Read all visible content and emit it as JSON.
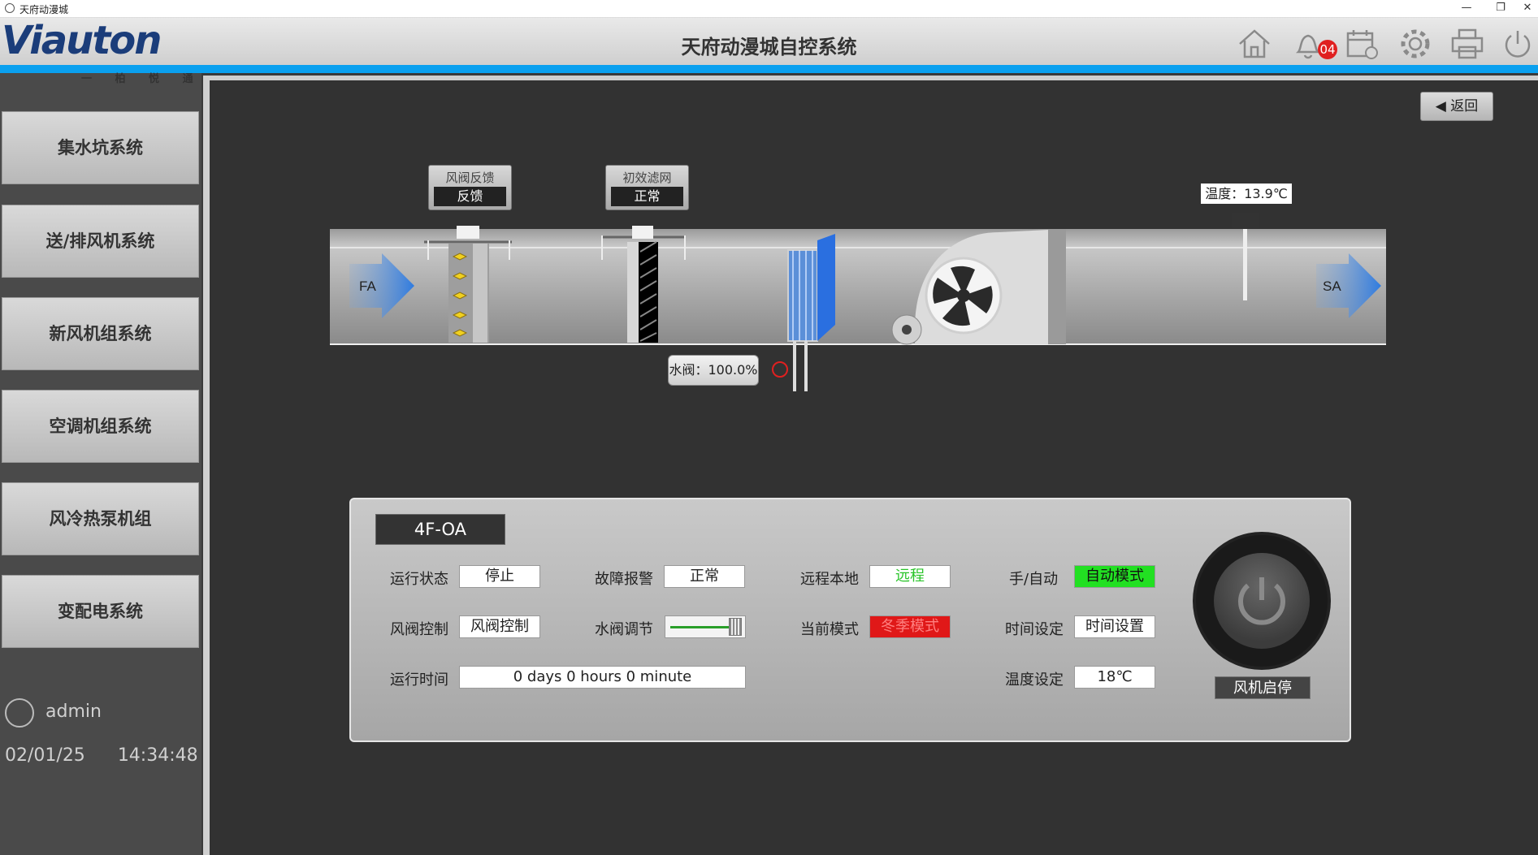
{
  "window": {
    "title": "天府动漫城",
    "minimize": "—",
    "restore": "❐",
    "close": "✕"
  },
  "header": {
    "logo": "Viauton",
    "logo_sub": "一 柏 悦 通 一",
    "title": "天府动漫城自控系统",
    "alarm_count": "04"
  },
  "header_icons": [
    "home-icon",
    "bell-icon",
    "calendar-icon",
    "gear-icon",
    "printer-icon",
    "power-icon"
  ],
  "sidebar": {
    "items": [
      {
        "label": "集水坑系统"
      },
      {
        "label": "送/排风机系统"
      },
      {
        "label": "新风机组系统"
      },
      {
        "label": "空调机组系统"
      },
      {
        "label": "风冷热泵机组"
      },
      {
        "label": "变配电系统"
      }
    ],
    "user": "admin",
    "date": "02/01/25",
    "time": "14:34:48"
  },
  "back_button": "返回",
  "diagram": {
    "damper_feedback": {
      "label": "风阀反馈",
      "value": "反馈"
    },
    "filter": {
      "label": "初效滤网",
      "value": "正常"
    },
    "inlet": "FA",
    "outlet": "SA",
    "temperature": "温度：13.9℃",
    "water_valve": "水阀：100.0%"
  },
  "panel": {
    "unit_name": "4F-OA",
    "run_status": {
      "label": "运行状态",
      "value": "停止"
    },
    "fault_alarm": {
      "label": "故障报警",
      "value": "正常"
    },
    "remote_local": {
      "label": "远程本地",
      "value": "远程"
    },
    "manual_auto": {
      "label": "手/自动",
      "value": "自动模式"
    },
    "damper_control": {
      "label": "风阀控制",
      "value": "风阀控制"
    },
    "water_valve_adjust": {
      "label": "水阀调节",
      "level": 1.0
    },
    "current_mode": {
      "label": "当前模式",
      "value": "冬季模式"
    },
    "time_setting": {
      "label": "时间设定",
      "value": "时间设置"
    },
    "run_time": {
      "label": "运行时间",
      "value": "0 days 0 hours 0 minute"
    },
    "temp_setting": {
      "label": "温度设定",
      "value": "18℃"
    },
    "fan_start_stop": "风机启停"
  },
  "colors": {
    "accent_blue": "#0aa0ef",
    "status_green": "#22e022",
    "mode_red": "#e01818"
  }
}
